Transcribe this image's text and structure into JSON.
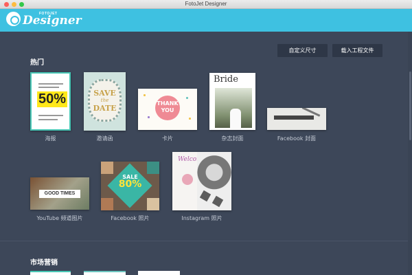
{
  "window": {
    "title": "FotoJet Designer"
  },
  "header": {
    "logo_small": "FOTOJET",
    "logo_text": "Designer"
  },
  "toolbar": {
    "custom_size": "自定义尺寸",
    "load_project": "载入工程文件"
  },
  "sections": [
    {
      "title": "热门",
      "items": [
        {
          "label": "海报"
        },
        {
          "label": "邀请函"
        },
        {
          "label": "卡片"
        },
        {
          "label": "杂志封面"
        },
        {
          "label": "Facebook 封面"
        },
        {
          "label": "YouTube 频道图片"
        },
        {
          "label": "Facebook 照片"
        },
        {
          "label": "Instagram 照片"
        }
      ]
    },
    {
      "title": "市场营销"
    }
  ],
  "thumbs": {
    "poster": {
      "big": "50%"
    },
    "invite": {
      "line1": "SAVE",
      "line2": "the",
      "line3": "DATE"
    },
    "card": {
      "line1": "THANK",
      "line2": "YOU"
    },
    "magazine": {
      "title": "Bride"
    },
    "youtube": {
      "sign": "GOOD TIMES"
    },
    "fbpost": {
      "sale": "SALE",
      "pct": "80%"
    },
    "insta": {
      "welcome": "Welcome"
    }
  },
  "colors": {
    "header": "#3ec1e1",
    "background": "#3d4759",
    "button": "#2e3747"
  }
}
